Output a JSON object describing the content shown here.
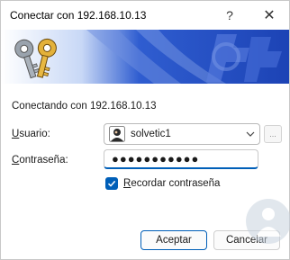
{
  "window": {
    "title": "Conectar con 192.168.10.13",
    "help_glyph": "?",
    "close_glyph": "✕"
  },
  "banner": {
    "icon": "keys-icon",
    "colors": {
      "dark": "#1c43b5",
      "light": "#b9cdf4",
      "white": "#ffffff"
    }
  },
  "message": "Conectando con 192.168.10.13",
  "user": {
    "label_prefix": "",
    "label_underlined": "U",
    "label_rest": "suario:",
    "value": "solvetic1",
    "browse_label": "..."
  },
  "password": {
    "label_prefix": "",
    "label_underlined": "C",
    "label_rest": "ontraseña:",
    "masked_value": "●●●●●●●●●●●"
  },
  "remember": {
    "label_prefix": "",
    "label_underlined": "R",
    "label_rest": "ecordar contraseña",
    "checked": true
  },
  "buttons": {
    "ok": "Aceptar",
    "cancel": "Cancelar"
  },
  "accent_color": "#005fb8"
}
